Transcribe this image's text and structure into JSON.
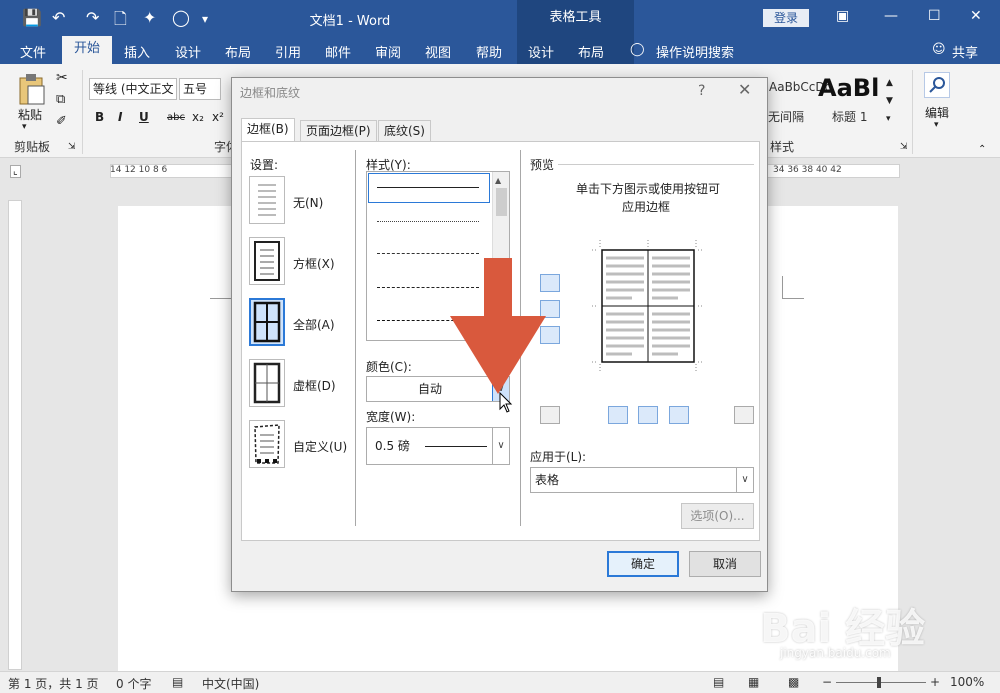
{
  "titlebar": {
    "doc_title": "文档1 - Word",
    "context_group": "表格工具",
    "login": "登录"
  },
  "tabs": [
    "文件",
    "开始",
    "插入",
    "设计",
    "布局",
    "引用",
    "邮件",
    "审阅",
    "视图",
    "帮助",
    "设计",
    "布局"
  ],
  "tell_me": "操作说明搜索",
  "share": "共享",
  "ribbon": {
    "paste": "粘贴",
    "clipboard": "剪贴板",
    "font_name": "等线 (中文正文",
    "font_size": "五号",
    "font_group": "字体",
    "styles_label": "样式",
    "style_preview_1": "AaBbCcDd",
    "style_name_1": "无间隔",
    "style_preview_2": "AaBl",
    "style_name_2": "标题 1",
    "edit": "编辑",
    "fmt_bold": "B",
    "fmt_italic": "I",
    "fmt_underline": "U",
    "fmt_strike": "abc",
    "fmt_sub": "x₂",
    "fmt_sup": "x²"
  },
  "ruler": {
    "left_nums": "14   12   10   8   6",
    "right_nums": "34   36   38   40   42"
  },
  "dialog": {
    "title": "边框和底纹",
    "help": "?",
    "tabs": [
      "边框(B)",
      "页面边框(P)",
      "底纹(S)"
    ],
    "setting_label": "设置:",
    "settings": [
      "无(N)",
      "方框(X)",
      "全部(A)",
      "虚框(D)",
      "自定义(U)"
    ],
    "style_label": "样式(Y):",
    "color_label": "颜色(C):",
    "color_value": "自动",
    "width_label": "宽度(W):",
    "width_value": "0.5 磅",
    "preview_label": "预览",
    "preview_hint_1": "单击下方图示或使用按钮可",
    "preview_hint_2": "应用边框",
    "apply_label": "应用于(L):",
    "apply_value": "表格",
    "options_btn": "选项(O)...",
    "ok_btn": "确定",
    "cancel_btn": "取消"
  },
  "statusbar": {
    "page": "第 1 页，共 1 页",
    "words": "0 个字",
    "language": "中文(中国)",
    "zoom": "100%"
  },
  "watermark": {
    "brand": "Bai 经验",
    "url": "jingyan.baidu.com"
  },
  "colors": {
    "word_blue": "#2b579a",
    "arrow_red": "#d9593d",
    "select_blue": "#2b79d7"
  }
}
